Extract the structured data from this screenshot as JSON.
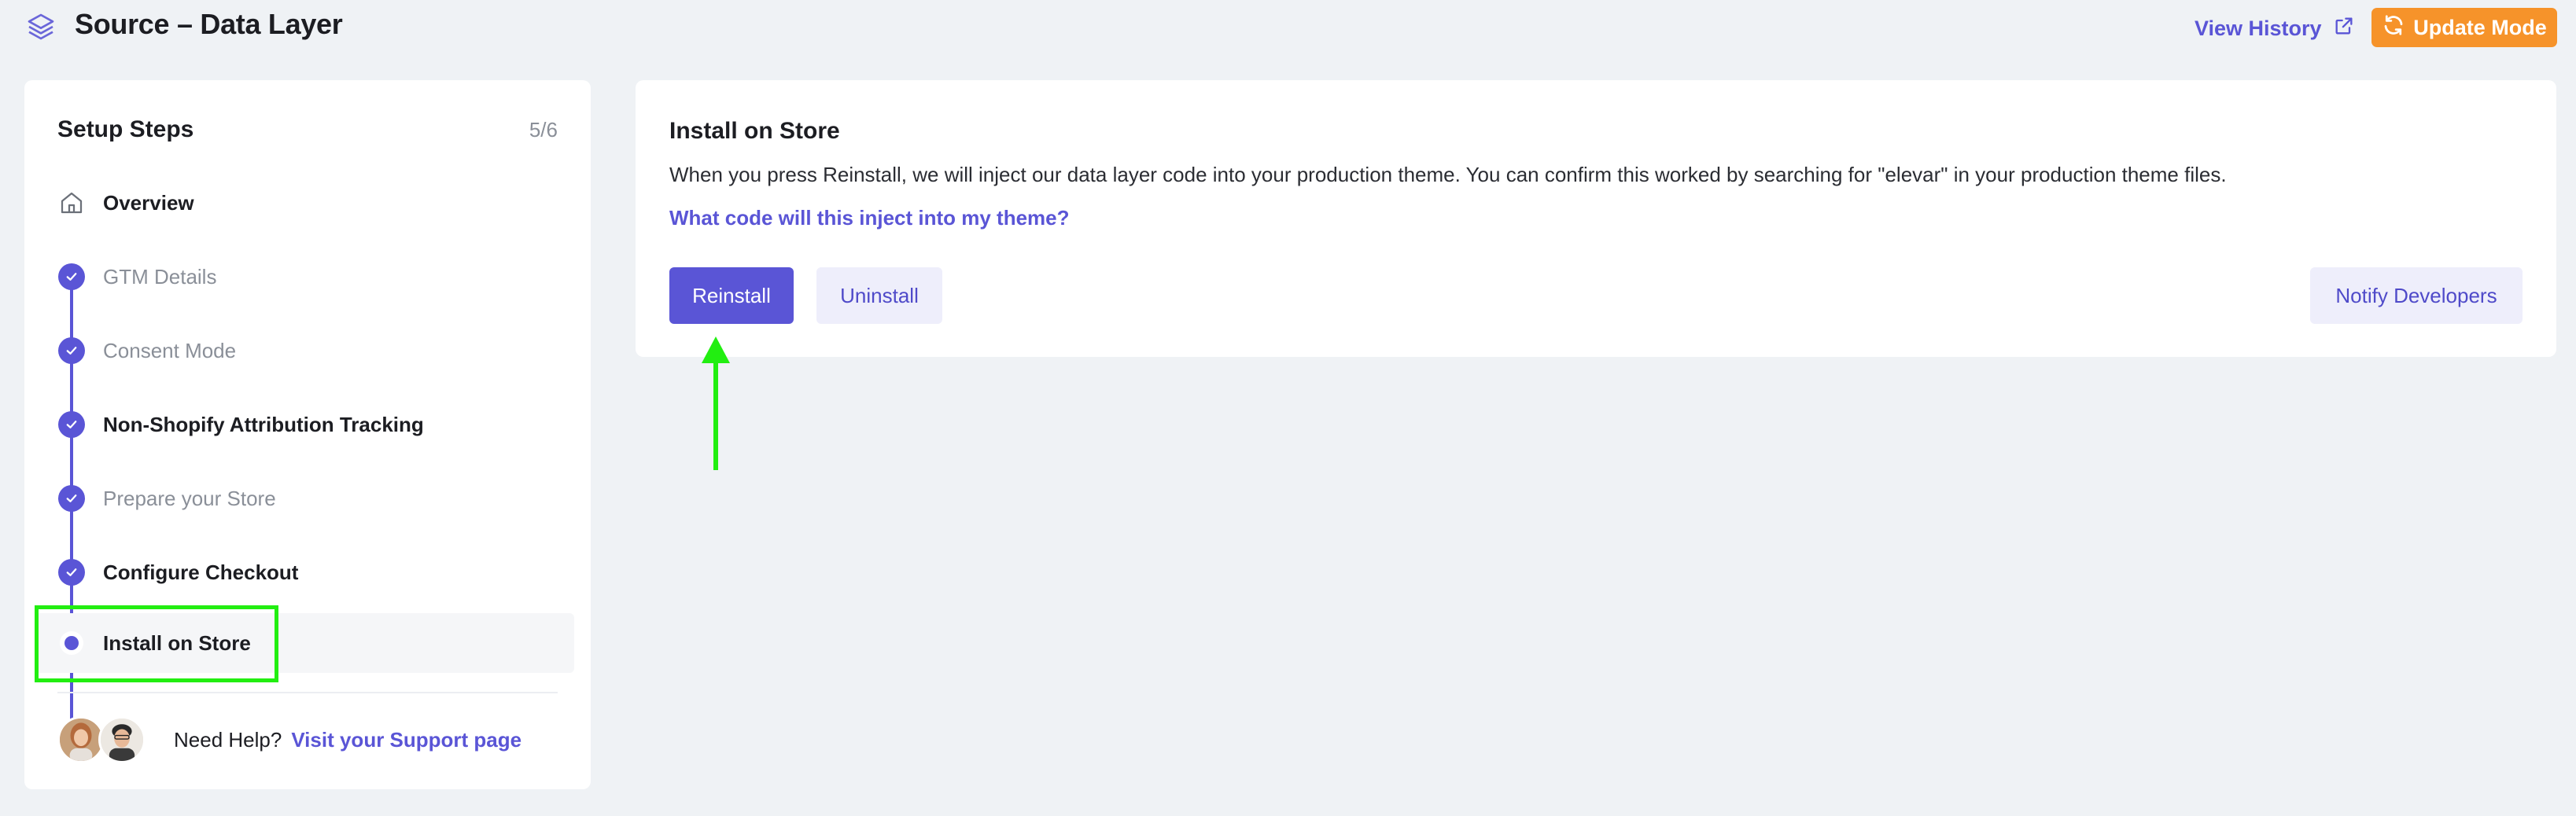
{
  "header": {
    "title": "Source – Data Layer",
    "view_history": "View History",
    "update_mode": "Update Mode",
    "icons": {
      "logo": "layers-icon",
      "external": "external-link-icon",
      "refresh": "refresh-icon"
    }
  },
  "sidebar": {
    "title": "Setup Steps",
    "count": "5/6",
    "steps": [
      {
        "label": "Overview",
        "state": "start"
      },
      {
        "label": "GTM Details",
        "state": "done"
      },
      {
        "label": "Consent Mode",
        "state": "done"
      },
      {
        "label": "Non-Shopify Attribution Tracking",
        "state": "done"
      },
      {
        "label": "Prepare your Store",
        "state": "done"
      },
      {
        "label": "Configure Checkout",
        "state": "done"
      },
      {
        "label": "Install on Store",
        "state": "active"
      }
    ],
    "help": {
      "text": "Need Help?",
      "link": "Visit your Support page"
    }
  },
  "main": {
    "title": "Install on Store",
    "description": "When you press Reinstall, we will inject our data layer code into your production theme. You can confirm this worked by searching for \"elevar\" in your production theme files.",
    "link": "What code will this inject into my theme?",
    "buttons": {
      "reinstall": "Reinstall",
      "uninstall": "Uninstall",
      "notify": "Notify Developers"
    }
  },
  "colors": {
    "accent": "#5a55d6",
    "orange": "#f6932a",
    "annotation": "#22ee11",
    "background": "#eff2f5"
  }
}
